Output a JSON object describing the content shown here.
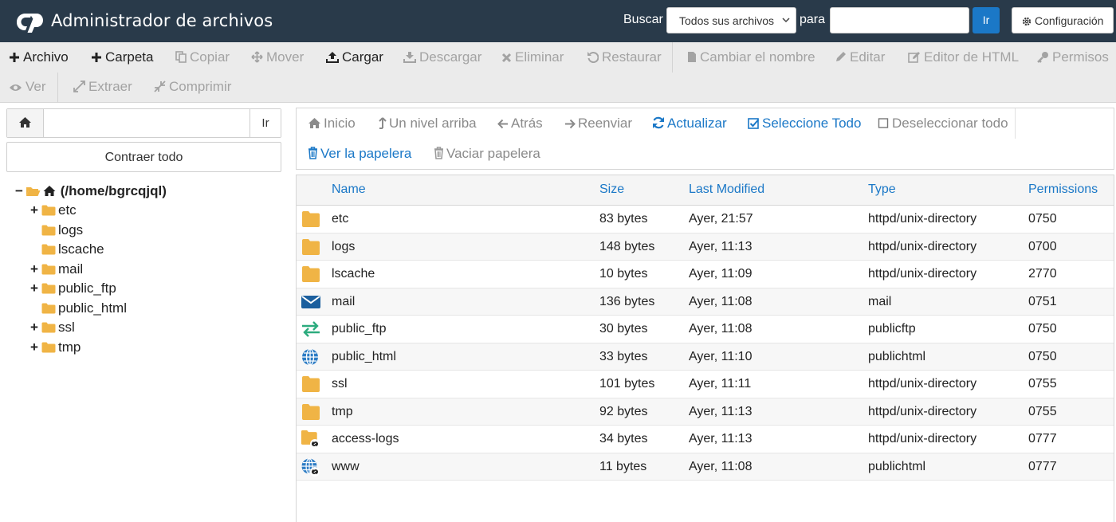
{
  "header": {
    "title": "Administrador de archivos",
    "search_label": "Buscar",
    "search_scope": "Todos sus archivos",
    "para_label": "para",
    "search_value": "",
    "go_label": "Ir",
    "config_label": "Configuración"
  },
  "toolbar": {
    "archivo": "Archivo",
    "carpeta": "Carpeta",
    "copiar": "Copiar",
    "mover": "Mover",
    "cargar": "Cargar",
    "descargar": "Descargar",
    "eliminar": "Eliminar",
    "restaurar": "Restaurar",
    "cambiar_nombre": "Cambiar el nombre",
    "editar": "Editar",
    "editor_html": "Editor de HTML",
    "permisos": "Permisos",
    "ver": "Ver",
    "extraer": "Extraer",
    "comprimir": "Comprimir"
  },
  "sidebar": {
    "path_value": "",
    "go_label": "Ir",
    "collapse_label": "Contraer todo",
    "root_label": "(/home/bgrcqjql)",
    "items": [
      {
        "label": "etc",
        "expander": "+"
      },
      {
        "label": "logs",
        "expander": ""
      },
      {
        "label": "lscache",
        "expander": ""
      },
      {
        "label": "mail",
        "expander": "+"
      },
      {
        "label": "public_ftp",
        "expander": "+"
      },
      {
        "label": "public_html",
        "expander": ""
      },
      {
        "label": "ssl",
        "expander": "+"
      },
      {
        "label": "tmp",
        "expander": "+"
      }
    ]
  },
  "nav": {
    "inicio": "Inicio",
    "nivel_arriba": "Un nivel arriba",
    "atras": "Atrás",
    "reenviar": "Reenviar",
    "actualizar": "Actualizar",
    "seleccione_todo": "Seleccione Todo",
    "deseleccionar_todo": "Deseleccionar todo",
    "ver_papelera": "Ver la papelera",
    "vaciar_papelera": "Vaciar papelera"
  },
  "table": {
    "headers": {
      "name": "Name",
      "size": "Size",
      "modified": "Last Modified",
      "type": "Type",
      "permissions": "Permissions"
    },
    "rows": [
      {
        "name": "etc",
        "size": "83 bytes",
        "modified": "Ayer, 21:57",
        "type": "httpd/unix-directory",
        "perms": "0750"
      },
      {
        "name": "logs",
        "size": "148 bytes",
        "modified": "Ayer, 11:13",
        "type": "httpd/unix-directory",
        "perms": "0700"
      },
      {
        "name": "lscache",
        "size": "10 bytes",
        "modified": "Ayer, 11:09",
        "type": "httpd/unix-directory",
        "perms": "2770"
      },
      {
        "name": "mail",
        "size": "136 bytes",
        "modified": "Ayer, 11:08",
        "type": "mail",
        "perms": "0751"
      },
      {
        "name": "public_ftp",
        "size": "30 bytes",
        "modified": "Ayer, 11:08",
        "type": "publicftp",
        "perms": "0750"
      },
      {
        "name": "public_html",
        "size": "33 bytes",
        "modified": "Ayer, 11:10",
        "type": "publichtml",
        "perms": "0750"
      },
      {
        "name": "ssl",
        "size": "101 bytes",
        "modified": "Ayer, 11:11",
        "type": "httpd/unix-directory",
        "perms": "0755"
      },
      {
        "name": "tmp",
        "size": "92 bytes",
        "modified": "Ayer, 11:13",
        "type": "httpd/unix-directory",
        "perms": "0755"
      },
      {
        "name": "access-logs",
        "size": "34 bytes",
        "modified": "Ayer, 11:13",
        "type": "httpd/unix-directory",
        "perms": "0777"
      },
      {
        "name": "www",
        "size": "11 bytes",
        "modified": "Ayer, 11:08",
        "type": "publichtml",
        "perms": "0777"
      }
    ]
  },
  "colors": {
    "header_bg": "#293a4a",
    "accent": "#1b78c7",
    "folder": "#f0b445",
    "disabled": "#a3a3a3"
  }
}
